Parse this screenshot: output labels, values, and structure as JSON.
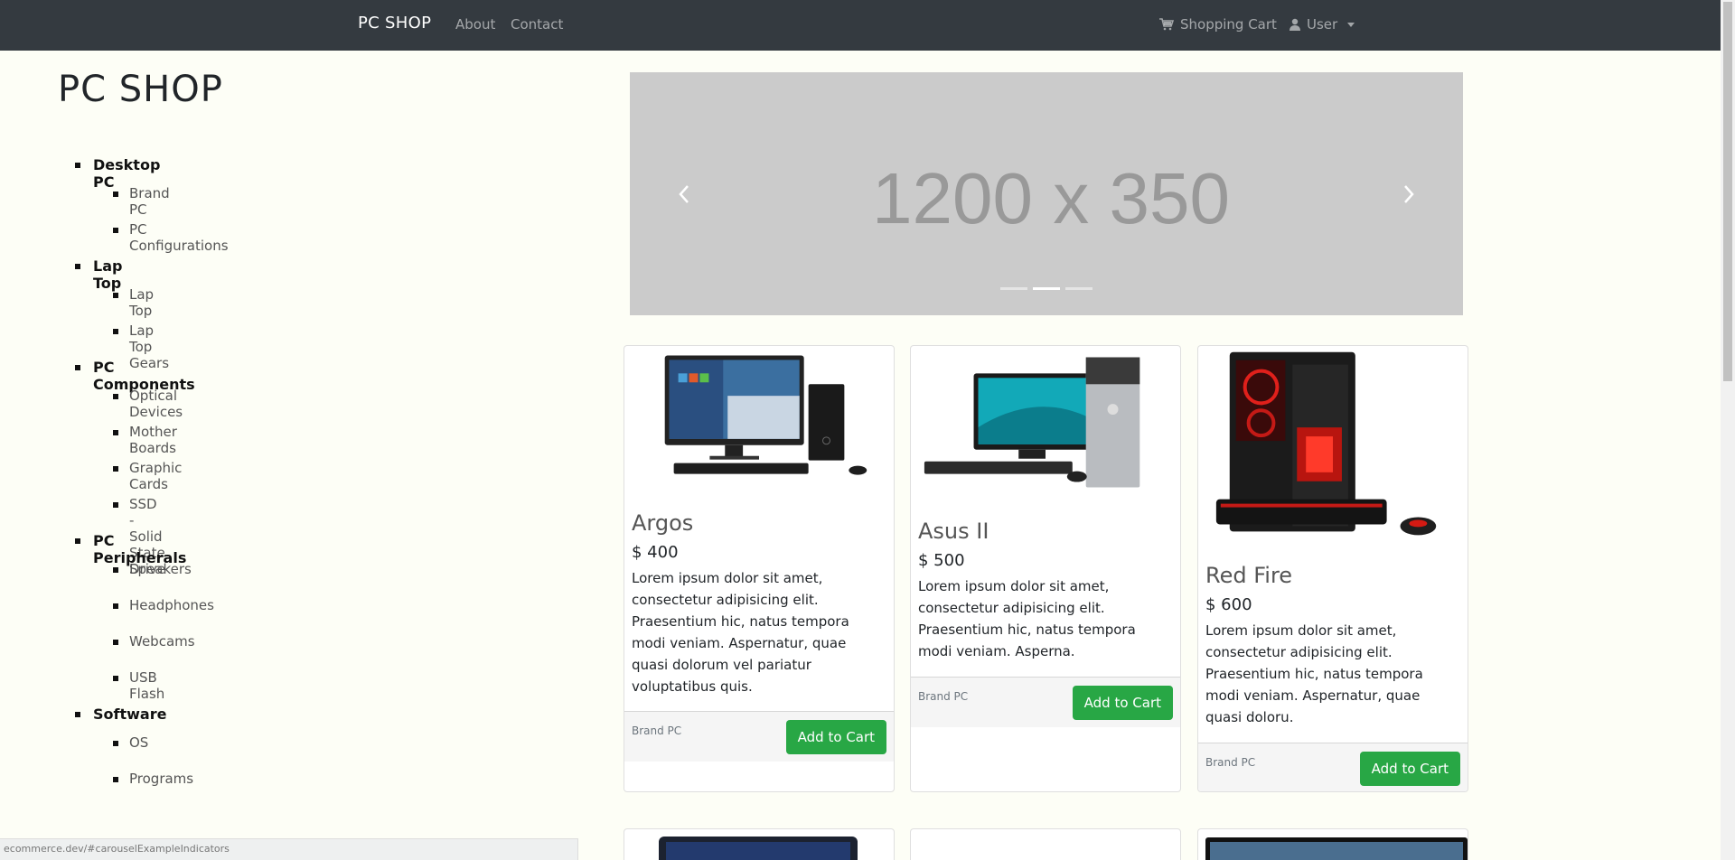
{
  "navbar": {
    "brand": "PC SHOP",
    "links": [
      "About",
      "Contact"
    ],
    "cart_label": "Shopping Cart",
    "user_label": "User"
  },
  "sidebar": {
    "title": "PC SHOP",
    "categories": [
      {
        "label": "Desktop PC",
        "items": [
          "Brand PC",
          "PC Configurations"
        ]
      },
      {
        "label": "Lap Top",
        "items": [
          "Lap Top",
          "Lap Top Gears"
        ]
      },
      {
        "label": "PC Components",
        "items": [
          "Optical Devices",
          "Mother Boards",
          "Graphic Cards",
          "SSD - Solid State Drive"
        ]
      },
      {
        "label": "PC Peripherals",
        "items": [
          "Speakers",
          "Headphones",
          "Webcams",
          "USB Flash"
        ]
      },
      {
        "label": "Software",
        "items": [
          "OS",
          "Programs"
        ]
      }
    ]
  },
  "carousel": {
    "placeholder_text": "1200 x 350",
    "slide_count": 3,
    "active_slide": 2
  },
  "products": [
    {
      "name": "Argos",
      "price": "$ 400",
      "description": "Lorem ipsum dolor sit amet, consectetur adipisicing elit. Praesentium hic, natus tempora modi veniam. Aspernatur, quae quasi dolorum vel pariatur voluptatibus quis.",
      "category": "Brand PC",
      "button_label": "Add to Cart"
    },
    {
      "name": "Asus II",
      "price": "$ 500",
      "description": "Lorem ipsum dolor sit amet, consectetur adipisicing elit. Praesentium hic, natus tempora modi veniam. Asperna.",
      "category": "Brand PC",
      "button_label": "Add to Cart"
    },
    {
      "name": "Red Fire",
      "price": "$ 600",
      "description": "Lorem ipsum dolor sit amet, consectetur adipisicing elit. Praesentium hic, natus tempora modi veniam. Aspernatur, quae quasi doloru.",
      "category": "Brand PC",
      "button_label": "Add to Cart"
    }
  ],
  "status_bar": "ecommerce.dev/#carouselExampleIndicators",
  "colors": {
    "navbar": "#343a40",
    "background": "#fdfef6",
    "button": "#28a745",
    "carousel": "#cbcbcb"
  }
}
